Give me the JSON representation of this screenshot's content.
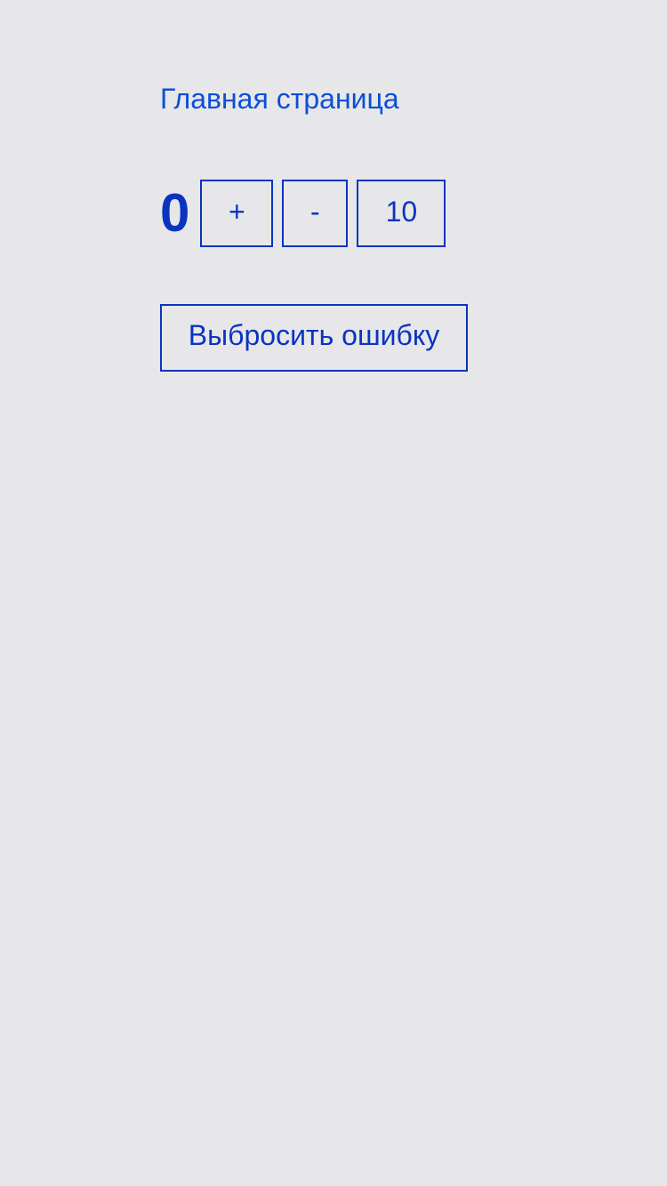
{
  "nav": {
    "home_link": "Главная страница"
  },
  "counter": {
    "value": "0",
    "increment_label": "+",
    "decrement_label": "-",
    "add_ten_label": "10"
  },
  "actions": {
    "throw_error_label": "Выбросить ошибку"
  },
  "colors": {
    "background": "#e7e7e9",
    "link": "#0a4fd8",
    "accent": "#0a34c0"
  }
}
